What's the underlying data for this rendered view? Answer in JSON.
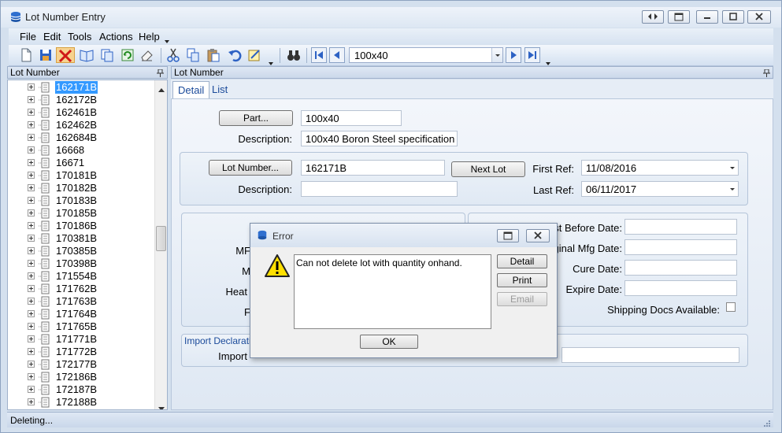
{
  "window": {
    "title": "Lot Number Entry"
  },
  "menu": [
    "File",
    "Edit",
    "Tools",
    "Actions",
    "Help"
  ],
  "toolbar": {
    "combo_value": "100x40"
  },
  "left_pane": {
    "header": "Lot Number",
    "items": [
      "162171B",
      "162172B",
      "162461B",
      "162462B",
      "162684B",
      "16668",
      "16671",
      "170181B",
      "170182B",
      "170183B",
      "170185B",
      "170186B",
      "170381B",
      "170385B",
      "170398B",
      "171554B",
      "171762B",
      "171763B",
      "171764B",
      "171765B",
      "171771B",
      "171772B",
      "172177B",
      "172186B",
      "172187B",
      "172188B"
    ]
  },
  "right_pane": {
    "header": "Lot Number",
    "tabs": [
      "Detail",
      "List"
    ],
    "part_button": "Part...",
    "part_value": "100x40",
    "description_label": "Description:",
    "description_value": "100x40 Boron Steel specification",
    "lot_number_button": "Lot Number...",
    "lot_number_value": "162171B",
    "next_lot_button": "Next Lot",
    "lot_description_label": "Description:",
    "lot_description_value": "",
    "first_ref_label": "First Ref:",
    "first_ref_value": "11/08/2016",
    "last_ref_label": "Last Ref:",
    "last_ref_value": "06/11/2017",
    "partial_labels": {
      "mf": "MF",
      "m": "M",
      "heat": "Heat",
      "f": "F",
      "import": "Import"
    },
    "best_before_label": "est Before Date:",
    "original_mfg_label": "iginal Mfg Date:",
    "cure_date_label": "Cure Date:",
    "expire_date_label": "Expire Date:",
    "shipping_docs_label": "Shipping Docs Available:",
    "import_group_title": "Import Declarati"
  },
  "status": {
    "text": "Deleting..."
  },
  "dialog": {
    "title": "Error",
    "message": "Can not delete lot with quantity onhand.",
    "detail_button": "Detail",
    "print_button": "Print",
    "email_button": "Email",
    "ok_button": "OK"
  }
}
